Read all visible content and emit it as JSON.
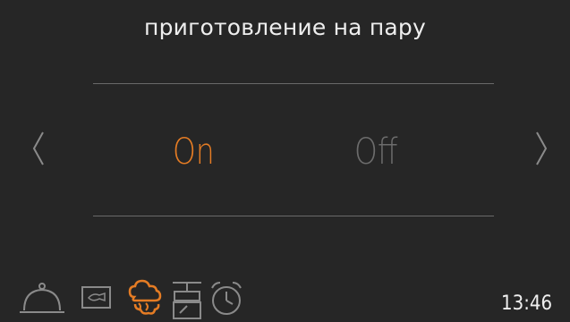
{
  "header": {
    "title": "приготовление на пару"
  },
  "selector": {
    "options": [
      {
        "label": "On",
        "selected": true
      },
      {
        "label": "Off",
        "selected": false
      }
    ]
  },
  "status": {
    "time": "13:46"
  },
  "icons": {
    "bottom_bar": [
      "cloche-icon",
      "camera-icon",
      "steam-icon",
      "scale-icon",
      "clock-icon"
    ],
    "nav": [
      "chevron-left-icon",
      "chevron-right-icon"
    ]
  },
  "colors": {
    "accent": "#e57c24",
    "inactive": "#6c6c6c",
    "background": "#262626"
  }
}
